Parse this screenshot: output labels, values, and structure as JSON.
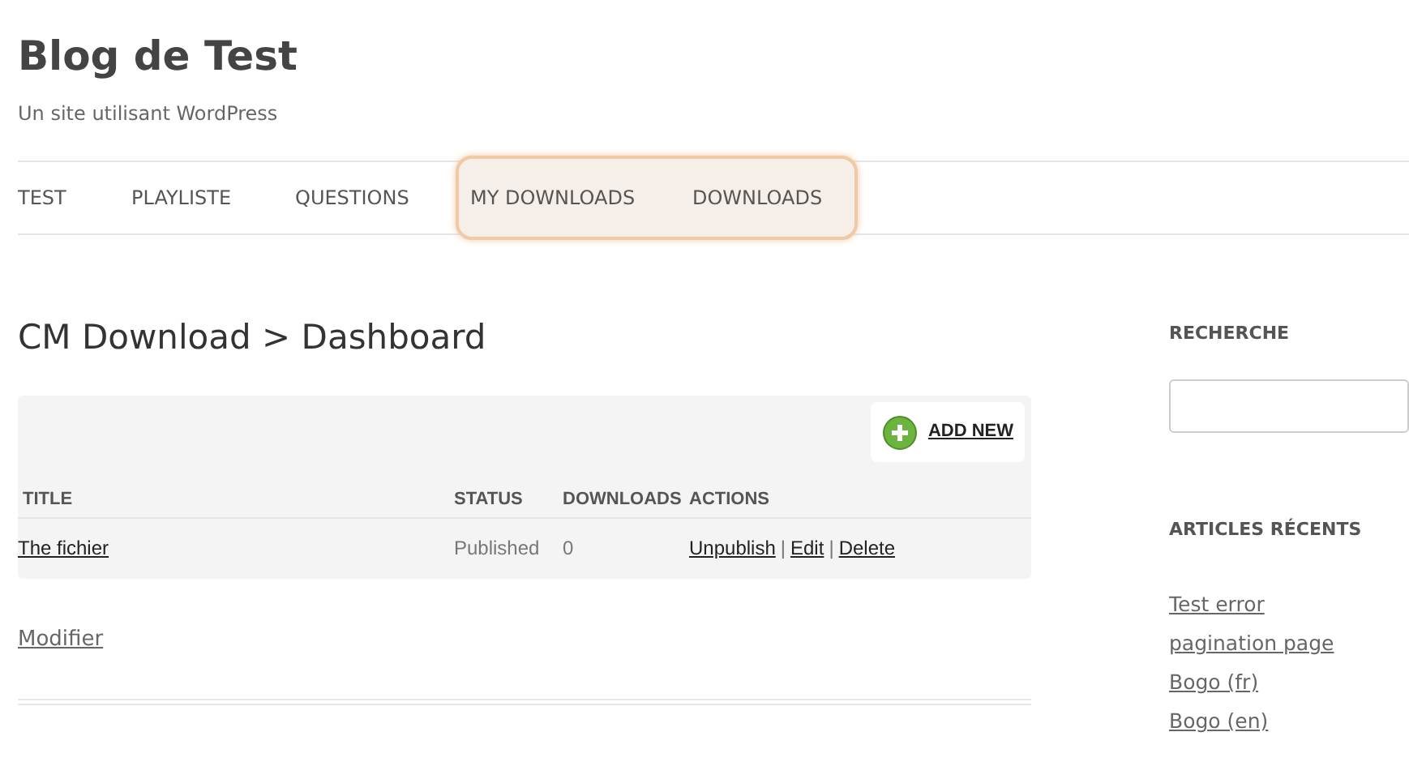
{
  "site": {
    "title": "Blog de Test",
    "tagline": "Un site utilisant WordPress"
  },
  "nav": [
    {
      "label": "TEST",
      "highlighted": false
    },
    {
      "label": "PLAYLISTE",
      "highlighted": false
    },
    {
      "label": "QUESTIONS",
      "highlighted": false
    },
    {
      "label": "MY DOWNLOADS",
      "highlighted": true
    },
    {
      "label": "DOWNLOADS",
      "highlighted": true
    }
  ],
  "page_title": "CM Download > Dashboard",
  "add_button": "ADD NEW",
  "table": {
    "columns": [
      "TITLE",
      "STATUS",
      "DOWNLOADS",
      "ACTIONS"
    ],
    "rows": [
      {
        "title": "The fichier",
        "status": "Published",
        "downloads": "0",
        "actions": [
          "Unpublish",
          "Edit",
          "Delete"
        ],
        "separator": "|"
      }
    ]
  },
  "edit_link": "Modifier",
  "sidebar": {
    "search_heading": "RECHERCHE",
    "recent_heading": "ARTICLES RÉCENTS",
    "recent": [
      "Test error",
      "pagination page",
      "Bogo (fr)",
      "Bogo (en)"
    ]
  }
}
